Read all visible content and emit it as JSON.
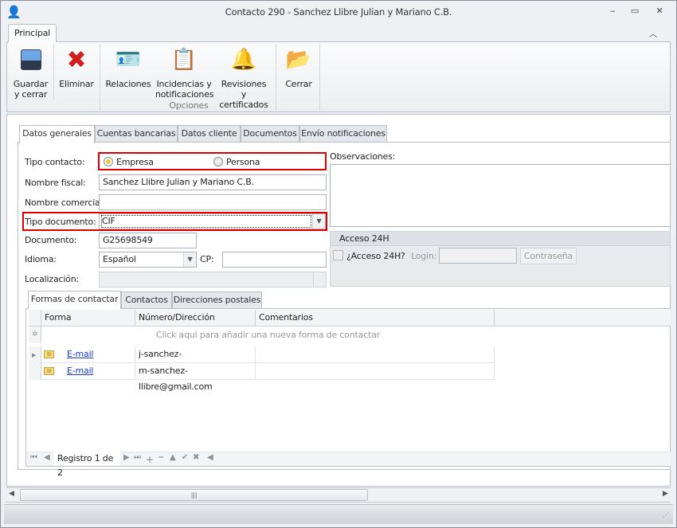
{
  "window": {
    "title": "Contacto 290 - Sanchez Llibre Julian y Mariano C.B.",
    "minimize": "‒",
    "maximize": "▭",
    "close": "✕"
  },
  "ribbon": {
    "tab": "Principal",
    "collapse": "︿",
    "buttons": {
      "save": "Guardar y cerrar",
      "delete": "Eliminar",
      "relations": "Relaciones",
      "incidents": "Incidencias y notificaciones",
      "reviews": "Revisiones y certificados",
      "close": "Cerrar"
    },
    "group_options": "Opciones"
  },
  "tabs": [
    "Datos generales",
    "Cuentas bancarias",
    "Datos cliente",
    "Documentos",
    "Envío notificaciones"
  ],
  "form": {
    "tipo_contacto_label": "Tipo contacto:",
    "opt_empresa": "Empresa",
    "opt_persona": "Persona",
    "nombre_fiscal_label": "Nombre fiscal:",
    "nombre_fiscal": "Sanchez Llibre Julian y Mariano C.B.",
    "nombre_comercial_label": "Nombre comercial:",
    "nombre_comercial": "",
    "tipo_documento_label": "Tipo documento:",
    "tipo_documento": "CIF",
    "documento_label": "Documento:",
    "documento": "G25698549",
    "idioma_label": "Idioma:",
    "idioma": "Español",
    "cp_label": "CP:",
    "cp": "",
    "localizacion_label": "Localización:",
    "observaciones_label": "Observaciones:",
    "acceso_title": "Acceso 24H",
    "acceso_check": "¿Acceso 24H?",
    "login_label": "Login:",
    "password_button": "Contraseña"
  },
  "subtabs": [
    "Formas de contactar",
    "Contactos",
    "Direcciones postales"
  ],
  "grid": {
    "columns": [
      "Forma",
      "Número/Dirección",
      "Comentarios"
    ],
    "new_row": "Click aquí para añadir una nueva forma de contactar",
    "rows": [
      {
        "forma": "E-mail",
        "valor": "j-sanchez-llibre@gmail.com",
        "comentarios": ""
      },
      {
        "forma": "E-mail",
        "valor": "m-sanchez-llibre@gmail.com",
        "comentarios": ""
      }
    ],
    "navigator": "Registro 1 de 2"
  },
  "colors": {
    "highlight": "#e00000",
    "radio_on": "#f7c520"
  }
}
